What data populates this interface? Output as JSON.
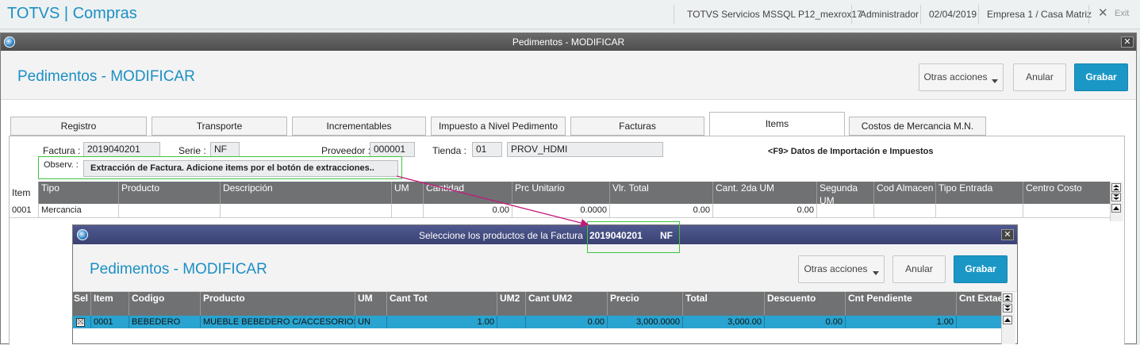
{
  "topbar": {
    "app_title": "TOTVS | Compras",
    "server": "TOTVS Servicios MSSQL P12_mexrox17",
    "user": "Administrador",
    "date": "02/04/2019",
    "company": "Empresa 1 / Casa Matriz",
    "exit_label": "Exit"
  },
  "window": {
    "title": "Pedimentos - MODIFICAR",
    "page_title": "Pedimentos - MODIFICAR",
    "buttons": {
      "other_actions": "Otras acciones",
      "cancel": "Anular",
      "save": "Grabar"
    }
  },
  "tabs": [
    "Registro",
    "Transporte",
    "Incrementables",
    "Impuesto a Nivel Pedimento",
    "Facturas",
    "Items",
    "Costos de Mercancia M.N."
  ],
  "form": {
    "factura_label": "Factura :",
    "factura_value": "2019040201",
    "serie_label": "Serie :",
    "serie_value": "NF",
    "proveedor_label": "Proveedor :",
    "proveedor_value": "000001",
    "tienda_label": "Tienda :",
    "tienda_value": "01",
    "tienda_name": "PROV_HDMI",
    "f9_hint": "<F9> Datos de Importación e Impuestos",
    "observ_label": "Observ. :",
    "observ_value": "Extracción de Factura. Adicione items por el botón de extracciones.."
  },
  "items_grid": {
    "columns": [
      "Item",
      "Tipo",
      "Producto",
      "Descripción",
      "UM",
      "Cantidad",
      "Prc Unitario",
      "Vlr. Total",
      "Cant. 2da UM",
      "Segunda UM",
      "Cod Almacen",
      "Tipo Entrada",
      "Centro Costo"
    ],
    "rows": [
      [
        "0001",
        "Mercancia",
        "",
        "",
        "",
        "0.00",
        "0.0000",
        "0.00",
        "0.00",
        "",
        "",
        "",
        ""
      ]
    ]
  },
  "dialog": {
    "title_prefix": "Seleccione los productos de la Factura",
    "title_factura": "2019040201",
    "title_serie": "NF",
    "page_title": "Pedimentos - MODIFICAR",
    "buttons": {
      "other_actions": "Otras acciones",
      "cancel": "Anular",
      "save": "Grabar"
    },
    "grid": {
      "columns": [
        "Sel",
        "Item",
        "Codigo",
        "Producto",
        "UM",
        "Cant Tot",
        "UM2",
        "Cant UM2",
        "Precio",
        "Total",
        "Descuento",
        "Cnt Pendiente",
        "Cnt Extaer"
      ],
      "rows": [
        [
          "☒",
          "0001",
          "BEBEDERO",
          "MUEBLE BEBEDERO C/ACCESORIOS C",
          "UN",
          "1.00",
          "",
          "0.00",
          "3,000.0000",
          "3,000.00",
          "0.00",
          "1.00",
          ""
        ]
      ]
    }
  },
  "colors": {
    "accent": "#1b8fc4",
    "primary_button": "#1b97c6",
    "grid_header": "#6f7173",
    "selected_row": "#29a3cf",
    "highlight_box": "#3fc43f",
    "arrow": "#c21a7a"
  }
}
